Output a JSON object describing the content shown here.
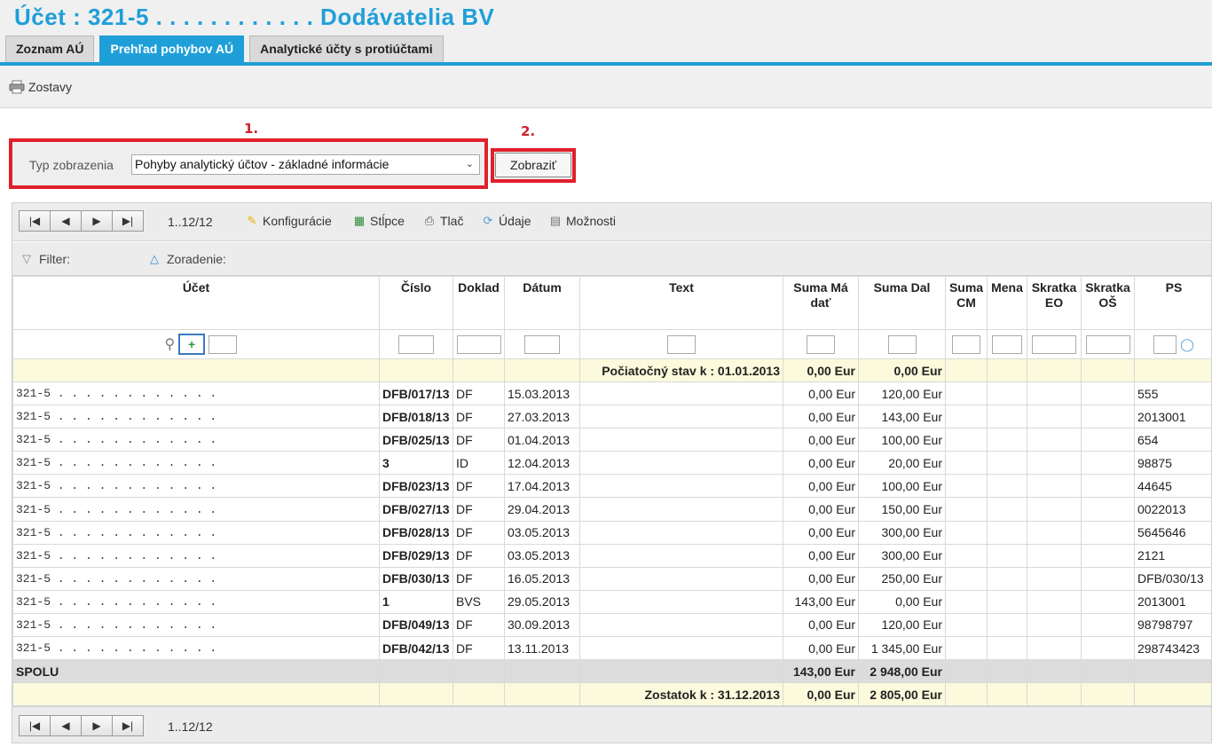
{
  "header": {
    "title": "Účet :  321-5 . . . . . . . . . . . . Dodávatelia BV"
  },
  "tabs": [
    {
      "label": "Zoznam AÚ"
    },
    {
      "label": "Prehľad pohybov AÚ"
    },
    {
      "label": "Analytické účty s protiúčtami"
    }
  ],
  "toolbar": {
    "zostavy_label": "Zostavy"
  },
  "annotations": {
    "one": "1.",
    "two": "2."
  },
  "form": {
    "typ_label": "Typ zobrazenia",
    "typ_value": "Pohyby analytický účtov - základné informácie",
    "zobrazit_label": "Zobraziť"
  },
  "grid": {
    "pager_range": "1..12/12",
    "tools": {
      "konfiguracie": "Konfigurácie",
      "stlpce": "Stĺpce",
      "tlac": "Tlač",
      "udaje": "Údaje",
      "moznosti": "Možnosti"
    },
    "filter_label": "Filter:",
    "zoradenie_label": "Zoradenie:",
    "columns": {
      "ucet": "Účet",
      "cislo": "Číslo",
      "doklad": "Doklad",
      "datum": "Dátum",
      "text": "Text",
      "suma_ma_dat": "Suma Má dať",
      "suma_dal": "Suma Dal",
      "suma_cm": "Suma CM",
      "mena": "Mena",
      "skratka_eo": "Skratka EO",
      "skratka_os": "Skratka OŠ",
      "ps": "PS"
    },
    "opening": {
      "text": "Počiatočný stav k : 01.01.2013",
      "ma_dat": "0,00 Eur",
      "dal": "0,00 Eur"
    },
    "rows": [
      {
        "ucet": "321-5  .  .  .  .    .    .    .    .    .    .    .    .",
        "cislo": "DFB/017/13",
        "doklad": "DF",
        "datum": "15.03.2013",
        "ma_dat": "0,00 Eur",
        "dal": "120,00 Eur",
        "ps": "555"
      },
      {
        "ucet": "321-5  .  .  .  .    .    .    .    .    .    .    .    .",
        "cislo": "DFB/018/13",
        "doklad": "DF",
        "datum": "27.03.2013",
        "ma_dat": "0,00 Eur",
        "dal": "143,00 Eur",
        "ps": "2013001"
      },
      {
        "ucet": "321-5  .  .  .  .    .    .    .    .    .    .    .    .",
        "cislo": "DFB/025/13",
        "doklad": "DF",
        "datum": "01.04.2013",
        "ma_dat": "0,00 Eur",
        "dal": "100,00 Eur",
        "ps": "654"
      },
      {
        "ucet": "321-5  .  .  .  .    .    .    .    .    .    .    .    .",
        "cislo": "3",
        "doklad": "ID",
        "datum": "12.04.2013",
        "ma_dat": "0,00 Eur",
        "dal": "20,00 Eur",
        "ps": "98875"
      },
      {
        "ucet": "321-5  .  .  .  .    .    .    .    .    .    .    .    .",
        "cislo": "DFB/023/13",
        "doklad": "DF",
        "datum": "17.04.2013",
        "ma_dat": "0,00 Eur",
        "dal": "100,00 Eur",
        "ps": "44645"
      },
      {
        "ucet": "321-5  .  .  .  .    .    .    .    .    .    .    .    .",
        "cislo": "DFB/027/13",
        "doklad": "DF",
        "datum": "29.04.2013",
        "ma_dat": "0,00 Eur",
        "dal": "150,00 Eur",
        "ps": "0022013"
      },
      {
        "ucet": "321-5  .  .  .  .    .    .    .    .    .    .    .    .",
        "cislo": "DFB/028/13",
        "doklad": "DF",
        "datum": "03.05.2013",
        "ma_dat": "0,00 Eur",
        "dal": "300,00 Eur",
        "ps": "5645646"
      },
      {
        "ucet": "321-5  .  .  .  .    .    .    .    .    .    .    .    .",
        "cislo": "DFB/029/13",
        "doklad": "DF",
        "datum": "03.05.2013",
        "ma_dat": "0,00 Eur",
        "dal": "300,00 Eur",
        "ps": "2121"
      },
      {
        "ucet": "321-5  .  .  .  .    .    .    .    .    .    .    .    .",
        "cislo": "DFB/030/13",
        "doklad": "DF",
        "datum": "16.05.2013",
        "ma_dat": "0,00 Eur",
        "dal": "250,00 Eur",
        "ps": "DFB/030/13"
      },
      {
        "ucet": "321-5  .  .  .  .    .    .    .    .    .    .    .    .",
        "cislo": "1",
        "doklad": "BVS",
        "datum": "29.05.2013",
        "ma_dat": "143,00 Eur",
        "dal": "0,00 Eur",
        "ps": "2013001"
      },
      {
        "ucet": "321-5  .  .  .  .    .    .    .    .    .    .    .    .",
        "cislo": "DFB/049/13",
        "doklad": "DF",
        "datum": "30.09.2013",
        "ma_dat": "0,00 Eur",
        "dal": "120,00 Eur",
        "ps": "98798797"
      },
      {
        "ucet": "321-5  .  .  .  .    .    .    .    .    .    .    .    .",
        "cislo": "DFB/042/13",
        "doklad": "DF",
        "datum": "13.11.2013",
        "ma_dat": "0,00 Eur",
        "dal": "1 345,00 Eur",
        "ps": "298743423"
      }
    ],
    "total": {
      "label": "SPOLU",
      "ma_dat": "143,00 Eur",
      "dal": "2 948,00 Eur"
    },
    "closing": {
      "text": "Zostatok k : 31.12.2013",
      "ma_dat": "0,00 Eur",
      "dal": "2 805,00 Eur"
    }
  }
}
